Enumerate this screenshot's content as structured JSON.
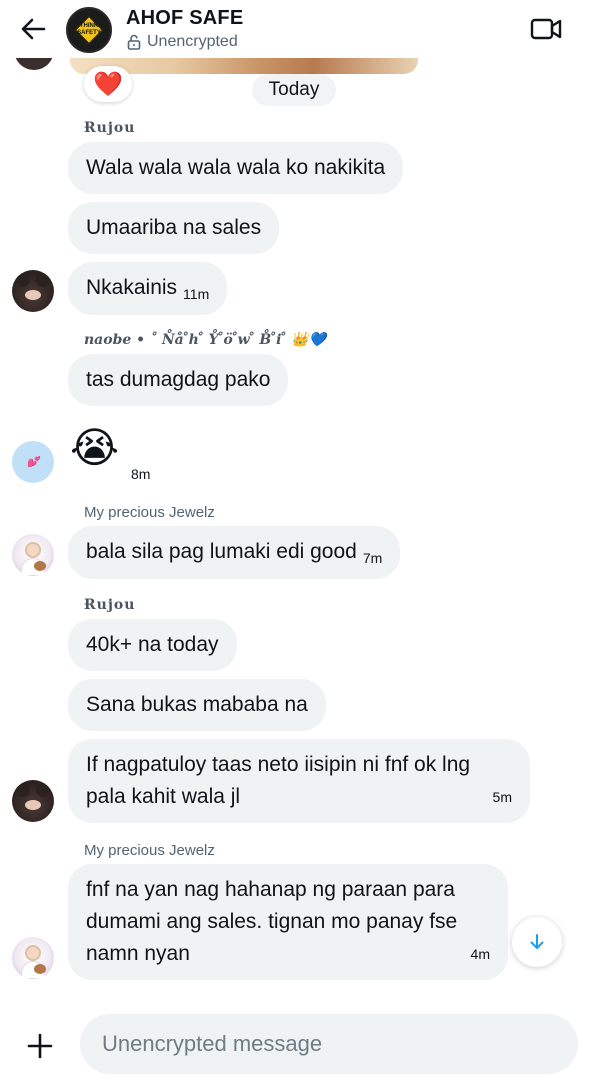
{
  "header": {
    "title": "AHOF SAFE",
    "subtitle": "Unencrypted",
    "group_avatar_text": "THINK SAFETY"
  },
  "reaction": "❤️",
  "date_separator": "Today",
  "messages": [
    {
      "sender": "Ɍujou",
      "text": "Wala wala wala wala ko nakikita"
    },
    {
      "text": "Umaariba na sales"
    },
    {
      "text": "Nkakainis",
      "time": "11m"
    },
    {
      "sender": "naobe • ˚ N̊å ̊h ̊ Y̊ ̊ö ̊w ̊ B̊ ̊i ̊ 👑💙",
      "text": "tas dumagdag pako"
    },
    {
      "text": "😭",
      "time": "8m"
    },
    {
      "sender": "My precious Jewelz",
      "text": "bala sila pag lumaki edi good",
      "time": "7m"
    },
    {
      "sender": "Ɍujou",
      "text": "40k+ na today"
    },
    {
      "text": "Sana bukas mababa na"
    },
    {
      "text_line1": "If nagpatuloy taas neto iisipin ni fnf ok lng",
      "text_line2": "pala kahit wala jl",
      "time": "5m"
    },
    {
      "sender": "My precious Jewelz",
      "text_line1": "fnf na yan nag hahanap ng paraan para",
      "text_line2": "dumami ang sales. tignan mo panay fse",
      "text_line3": "namn nyan",
      "time": "4m"
    }
  ],
  "composer": {
    "placeholder": "Unencrypted message"
  },
  "colors": {
    "bubble": "#eff3f4",
    "secondary_text": "#536471",
    "accent": "#1d9bf0"
  }
}
